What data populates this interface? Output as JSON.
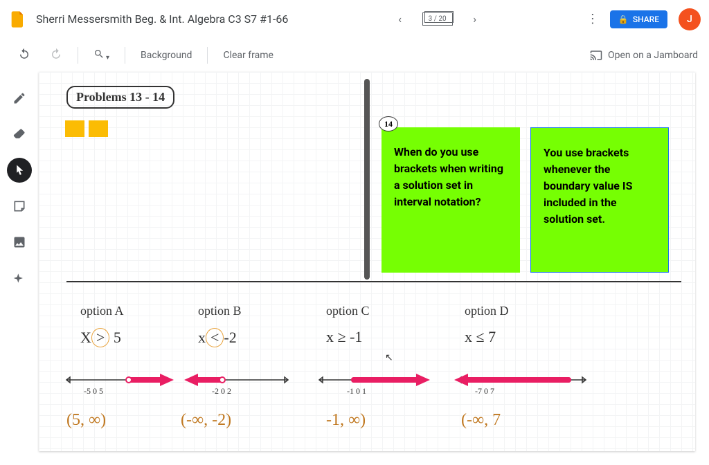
{
  "header": {
    "title": "Sherri Messersmith Beg. & Int. Algebra C3 S7 #1-66",
    "frame_indicator": "3 / 20",
    "share_label": "SHARE",
    "avatar_initial": "J"
  },
  "toolbar": {
    "background_label": "Background",
    "clear_label": "Clear frame",
    "cast_label": "Open on a Jamboard"
  },
  "canvas": {
    "title": "Problems 13 - 14",
    "badge14": "14",
    "sticky1": "When do you use brackets when writing a solution set in interval notation?",
    "sticky2": "You use brackets whenever the boundary value IS included in the solution set.",
    "options": {
      "A": {
        "label": "option A",
        "inequality_pre": "X",
        "op": ">",
        "inequality_post": " 5",
        "ticks": "-5  0  5",
        "interval": "(5, ∞)"
      },
      "B": {
        "label": "option B",
        "inequality_pre": "x",
        "op": "<",
        "inequality_post": "-2",
        "ticks": "-2  0  2",
        "interval": "(-∞, -2)"
      },
      "C": {
        "label": "option C",
        "inequality": "x ≥ -1",
        "ticks": "-1  0  1",
        "interval": "-1, ∞)"
      },
      "D": {
        "label": "option D",
        "inequality": "x ≤ 7",
        "ticks": "-7      0      7",
        "interval": "(-∞, 7"
      }
    }
  }
}
